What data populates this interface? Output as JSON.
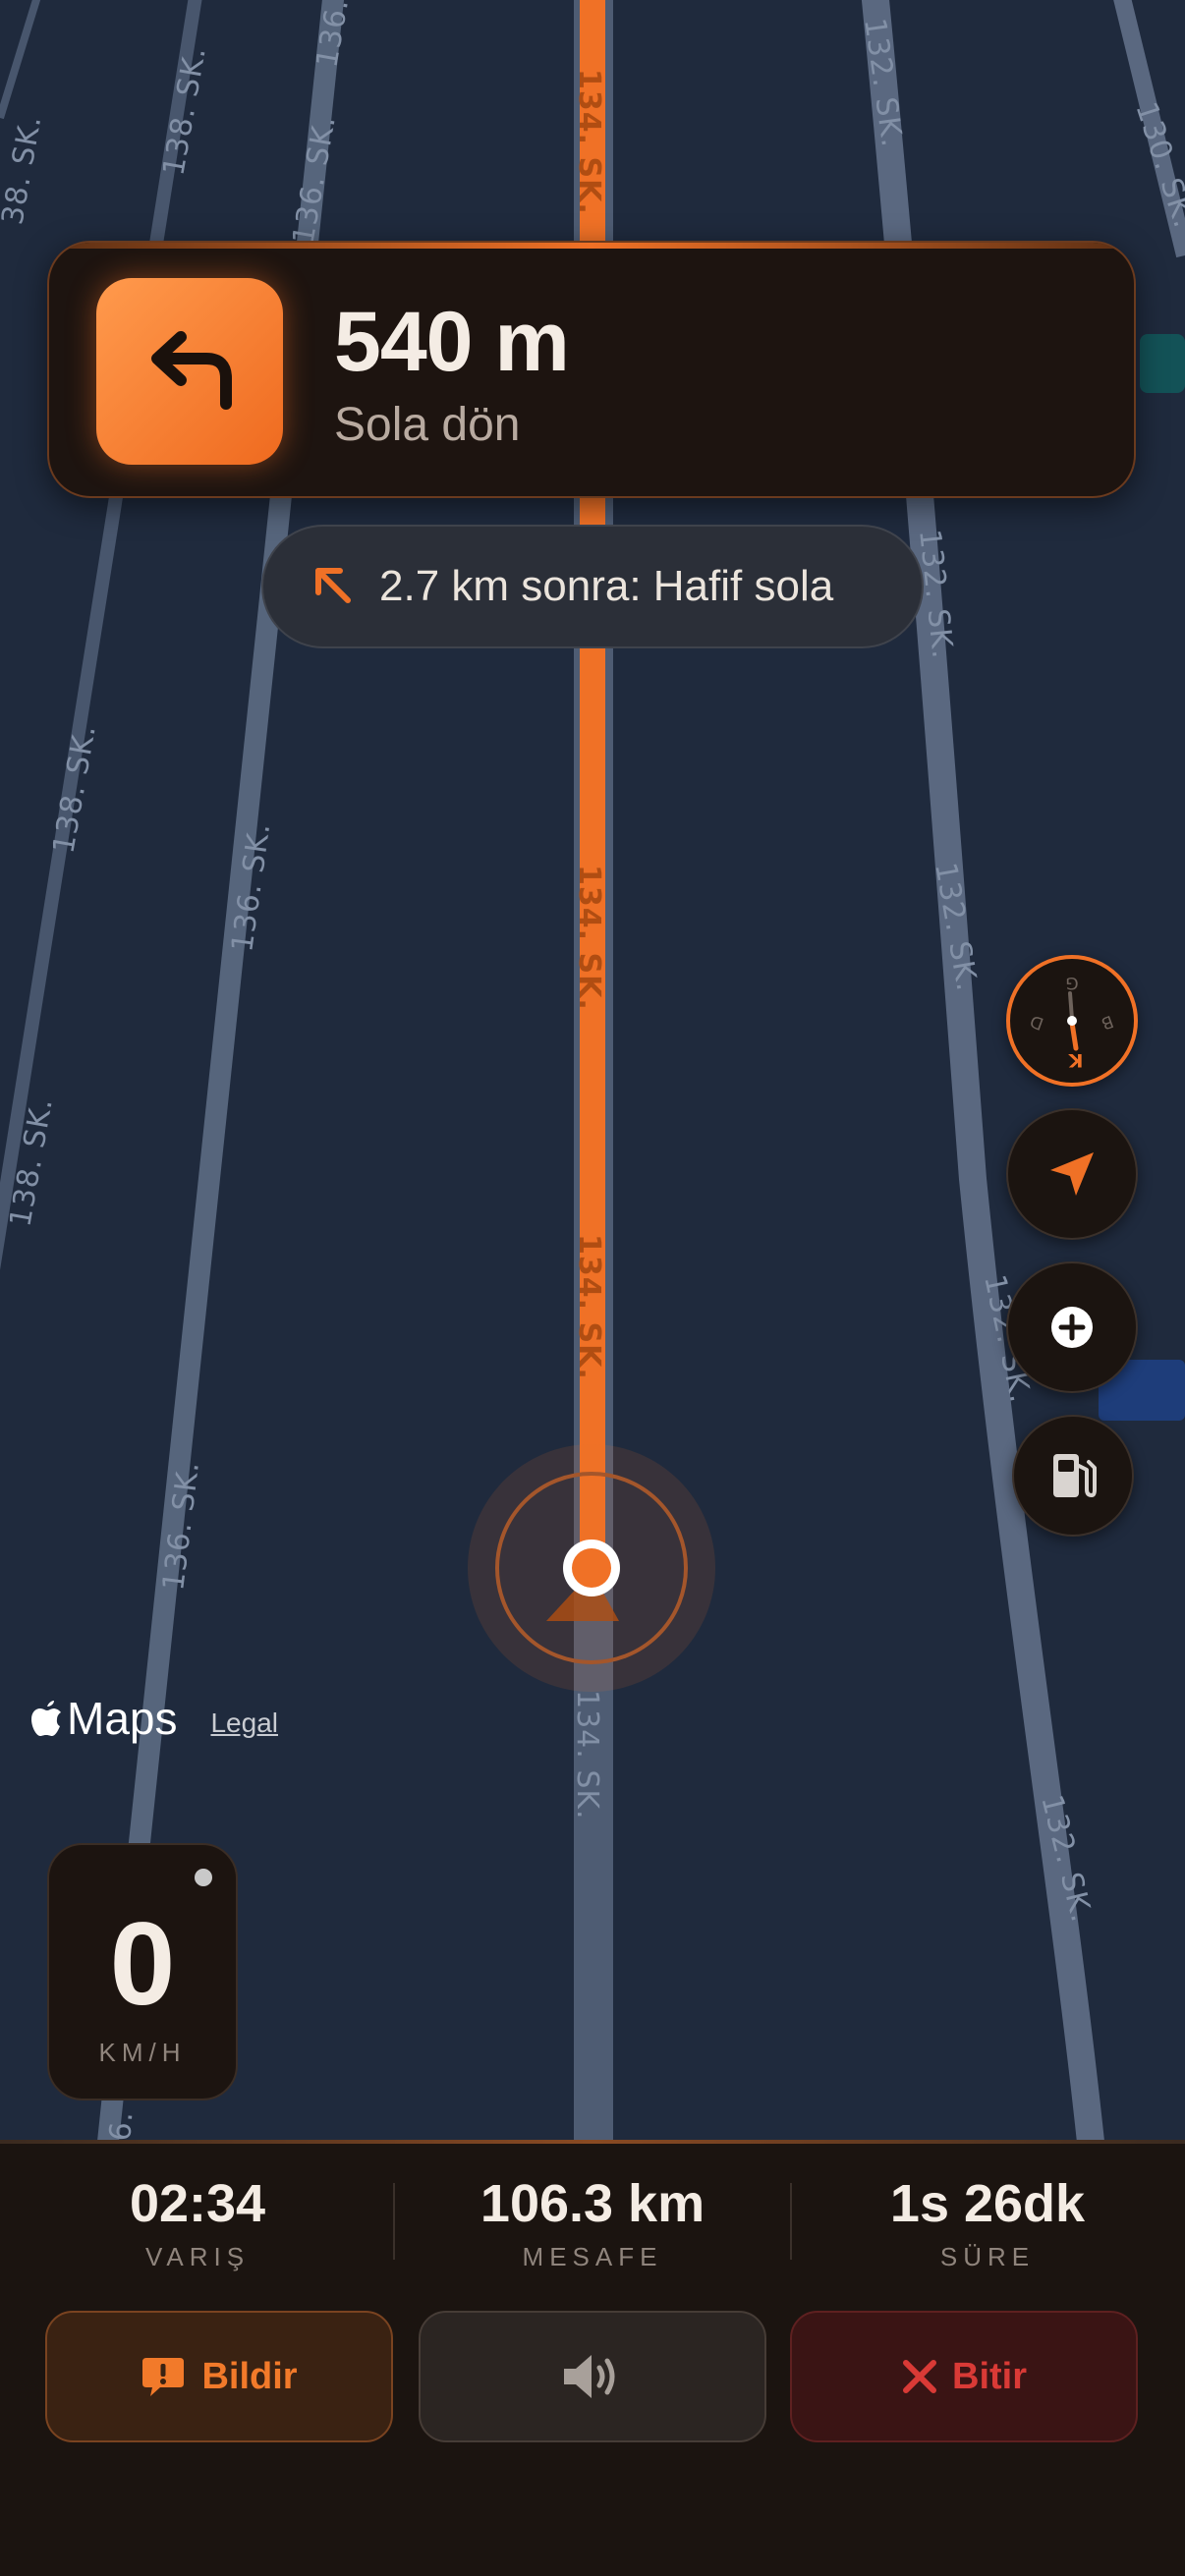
{
  "map": {
    "streets": {
      "s138a": "138. SK.",
      "s138b": "138. SK.",
      "s138c": "138. SK.",
      "s136a": "136.",
      "s136b": "136. SK.",
      "s136c": "136. SK.",
      "s136d": "136. SK.",
      "s136e": "6.",
      "s132a": "132. SK.",
      "s132b": "132. SK.",
      "s132c": "132. SK.",
      "s132d": "132. SK.",
      "s132e": "132. SK.",
      "s130": "130. SK.",
      "s134a": "134. SK.",
      "s134b": "134. SK.",
      "s134c": "134. SK.",
      "s134d": "134. SK.",
      "sLeftEdge": "38. SK."
    }
  },
  "maneuver": {
    "distance": "540 m",
    "instruction": "Sola dön",
    "icon": "turn-left-arrow-icon"
  },
  "next": {
    "text": "2.7 km sonra: Hafif sola",
    "icon": "slight-left-arrow-icon"
  },
  "controls": {
    "compass": {
      "n": "K",
      "s": "G",
      "e": "D",
      "w": "B"
    },
    "buttons": [
      "compass-icon",
      "location-arrow-icon",
      "add-icon",
      "fuel-pump-icon"
    ]
  },
  "attribution": {
    "brand": "Maps",
    "legal": "Legal"
  },
  "speed": {
    "value": "0",
    "unit": "KM/H"
  },
  "trip": {
    "arrival": {
      "value": "02:34",
      "label": "VARIŞ"
    },
    "distance": {
      "value": "106.3 km",
      "label": "MESAFE"
    },
    "duration": {
      "value": "1s 26dk",
      "label": "SÜRE"
    }
  },
  "actions": {
    "report": "Bildir",
    "sound": "speaker-icon",
    "finish": "Bitir"
  },
  "colors": {
    "accent": "#f07126",
    "danger": "#d93a36",
    "map_bg": "#1f2a3d"
  }
}
